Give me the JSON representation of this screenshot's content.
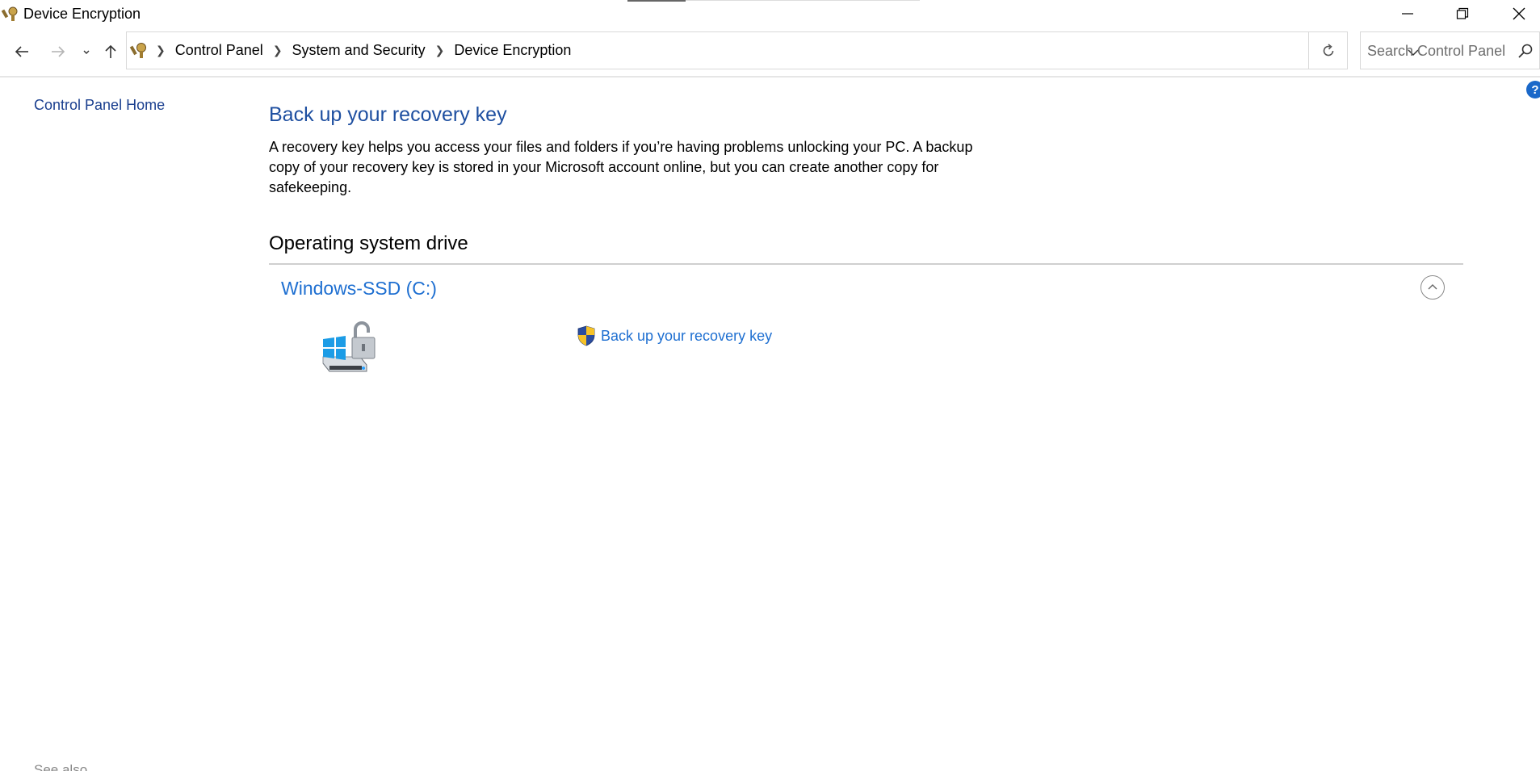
{
  "window": {
    "title": "Device Encryption"
  },
  "navigation": {
    "breadcrumbs": [
      "Control Panel",
      "System and Security",
      "Device Encryption"
    ],
    "search_placeholder": "Search Control Panel"
  },
  "left_pane": {
    "home_link": "Control Panel Home",
    "see_also": "See also"
  },
  "main": {
    "title": "Back up your recovery key",
    "description": "A recovery key helps you access your files and folders if you’re having problems unlocking your PC. A backup copy of your recovery key is stored in your Microsoft account online, but you can create another copy for safekeeping.",
    "section_title": "Operating system drive",
    "drive_name": "Windows-SSD (C:)",
    "action_link": "Back up your recovery key"
  },
  "colors": {
    "link": "#1e6fd1",
    "heading": "#1e4fa0",
    "left_link": "#1a3f8f"
  },
  "icons": [
    "control-panel-icon",
    "minimize-icon",
    "restore-icon",
    "close-icon",
    "back-arrow-icon",
    "forward-arrow-icon",
    "recent-locations-chevron-icon",
    "up-arrow-icon",
    "address-dropdown-icon",
    "refresh-icon",
    "search-icon",
    "help-icon",
    "collapse-chevron-icon",
    "encrypted-drive-icon",
    "uac-shield-icon"
  ]
}
